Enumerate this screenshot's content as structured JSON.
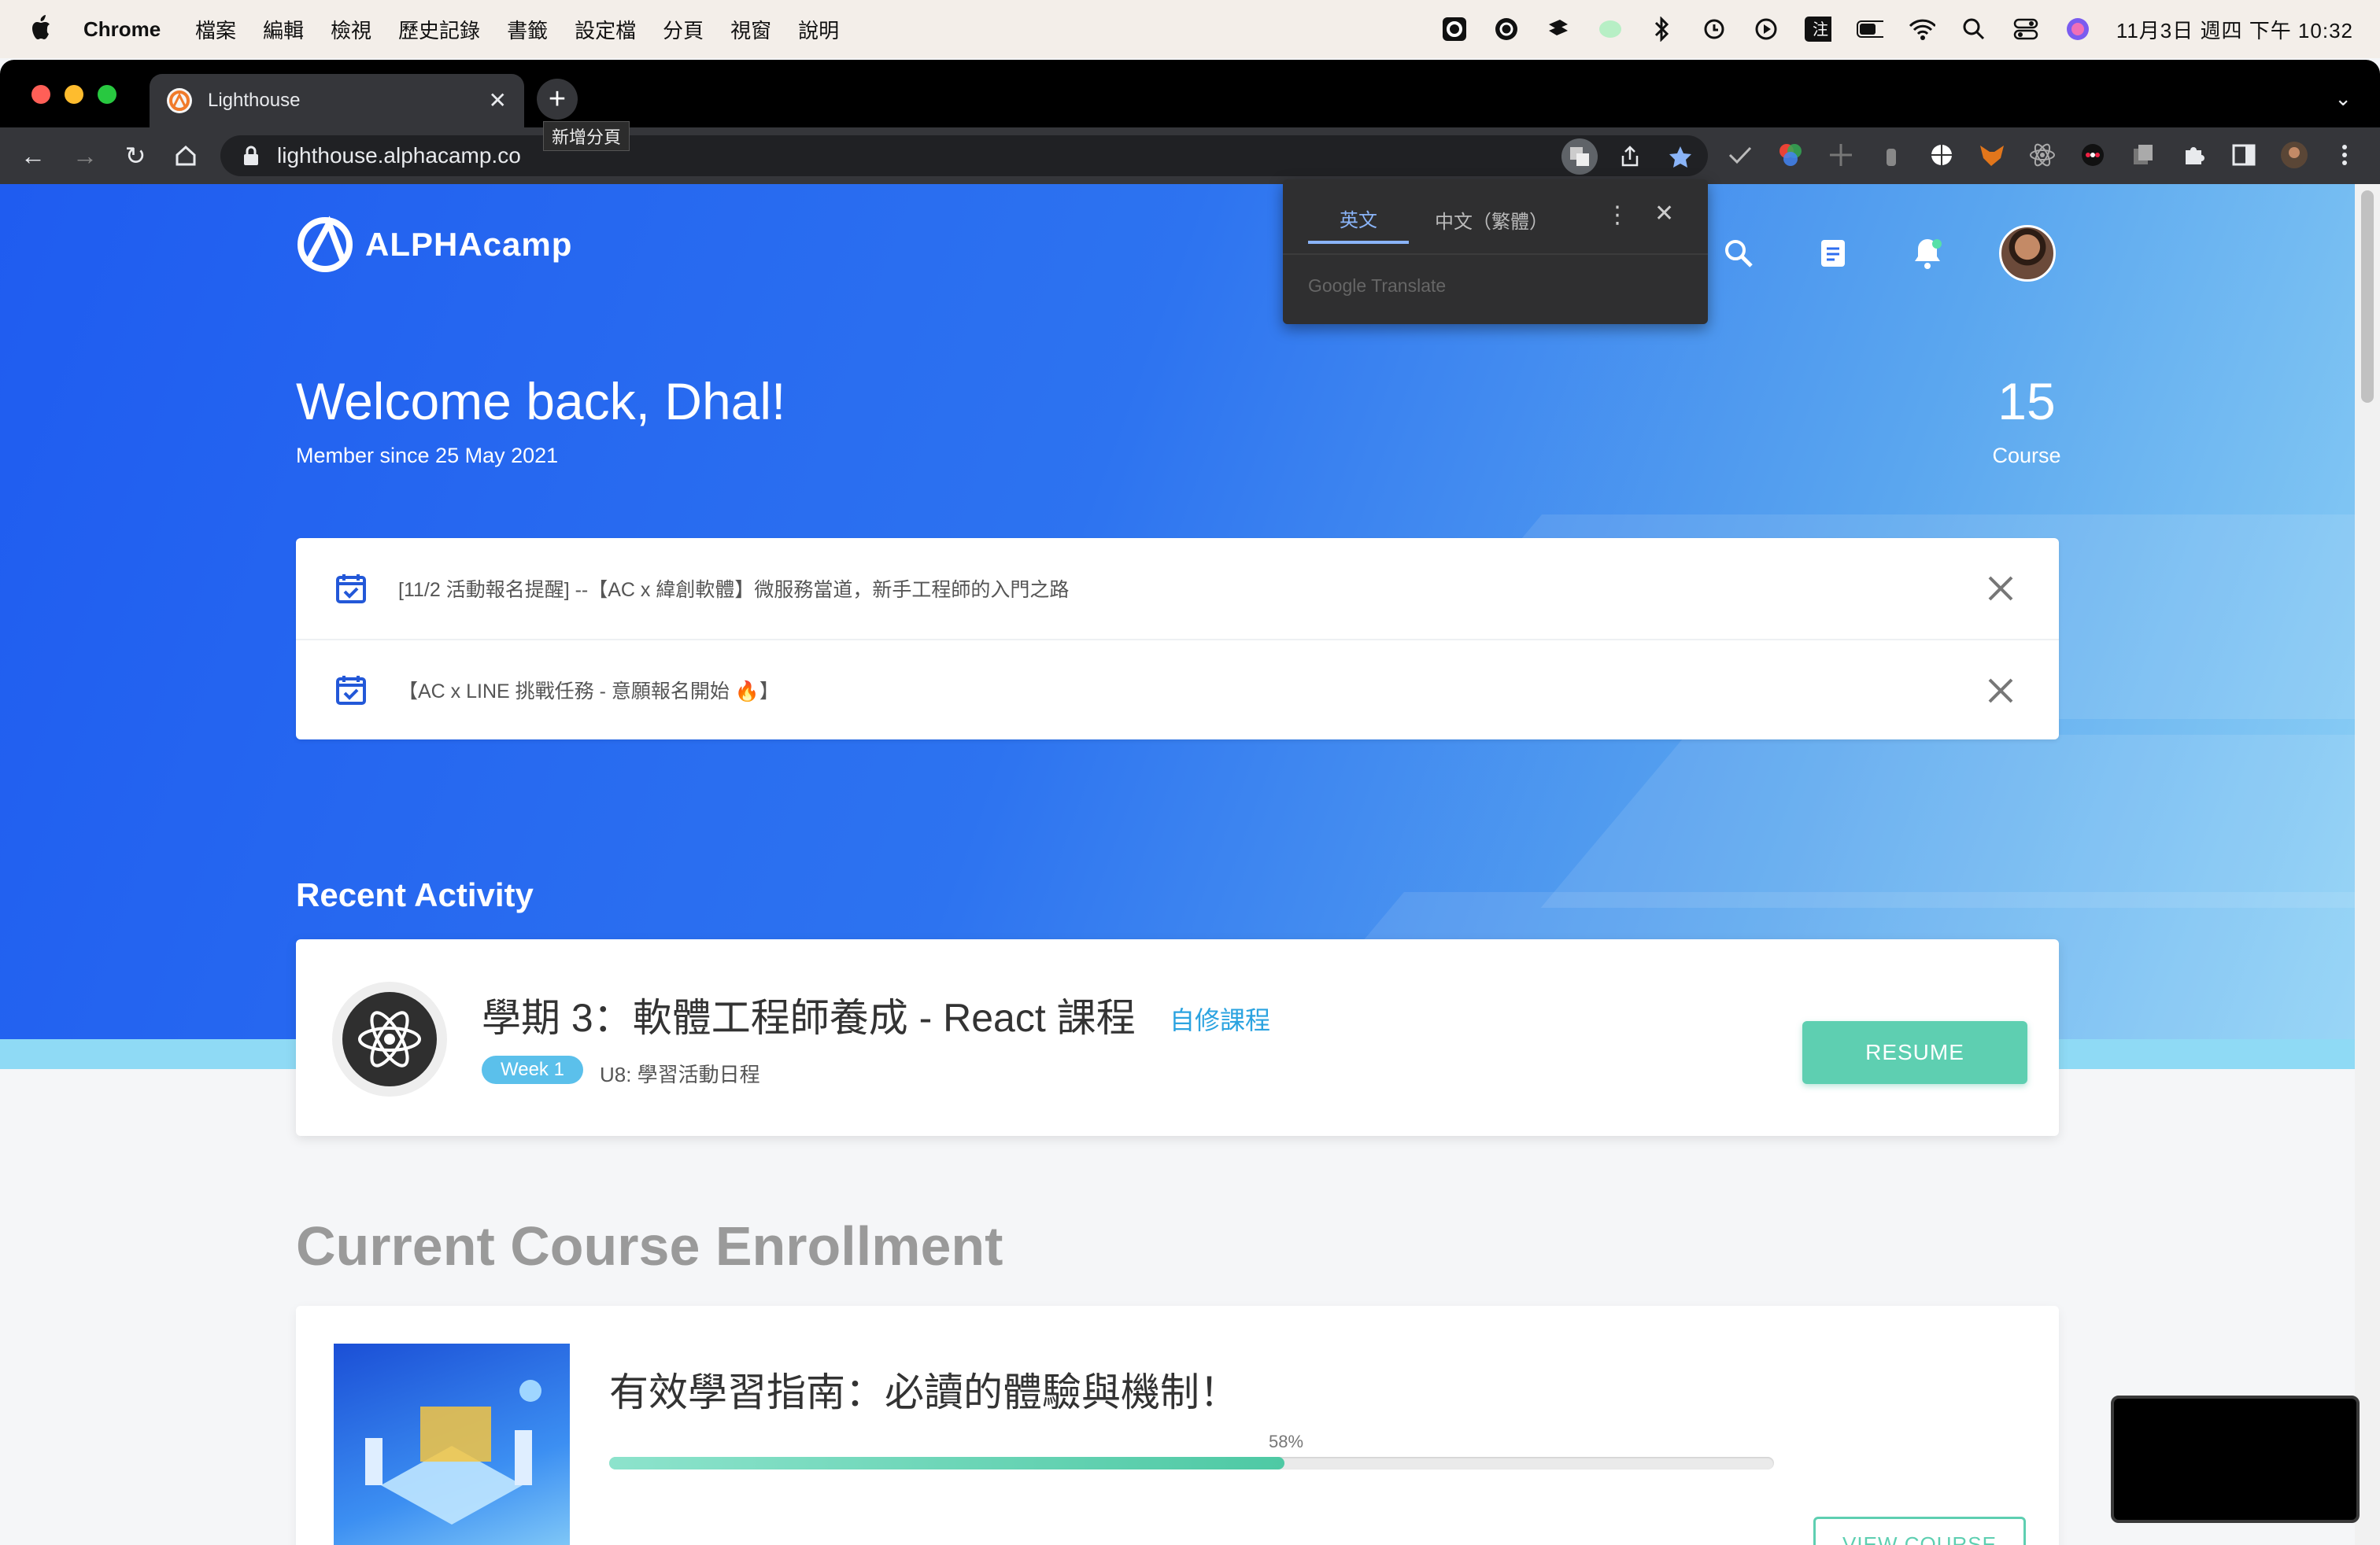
{
  "menubar": {
    "app": "Chrome",
    "menus": [
      "檔案",
      "編輯",
      "檢視",
      "歷史記錄",
      "書籤",
      "設定檔",
      "分頁",
      "視窗",
      "說明"
    ],
    "clock": "11月3日 週四 下午 10:32"
  },
  "browser": {
    "tab_title": "Lighthouse",
    "tab_close": "✕",
    "new_tab_tooltip": "新增分頁",
    "url": "lighthouse.alphacamp.co"
  },
  "translate_popup": {
    "tabs": [
      "英文",
      "中文（繁體）"
    ],
    "brand": "Google Translate"
  },
  "site": {
    "logo_text": "ALPHAcamp",
    "welcome": "Welcome back, Dhal!",
    "member_since": "Member since 25 May 2021",
    "course_count": "15",
    "course_label": "Course",
    "notices": [
      "[11/2 活動報名提醒] --【AC x 緯創軟體】微服務當道，新手工程師的入門之路",
      "【AC x LINE 挑戰任務 - 意願報名開始 🔥】"
    ],
    "recent_activity": {
      "heading": "Recent Activity",
      "title": "學期 3：軟體工程師養成 - React 課程",
      "tag": "自修課程",
      "week": "Week 1",
      "unit": "U8: 學習活動日程",
      "button": "RESUME"
    },
    "enrollment": {
      "heading": "Current Course Enrollment",
      "course": "有效學習指南：必讀的體驗與機制！",
      "progress_label": "58%",
      "progress": 0.58,
      "button": "VIEW COURSE"
    }
  },
  "colors": {
    "hero_start": "#1f5cf0",
    "hero_end": "#8fd2f5",
    "accent_green": "#5ecfb1",
    "week_badge": "#5bc0eb"
  }
}
